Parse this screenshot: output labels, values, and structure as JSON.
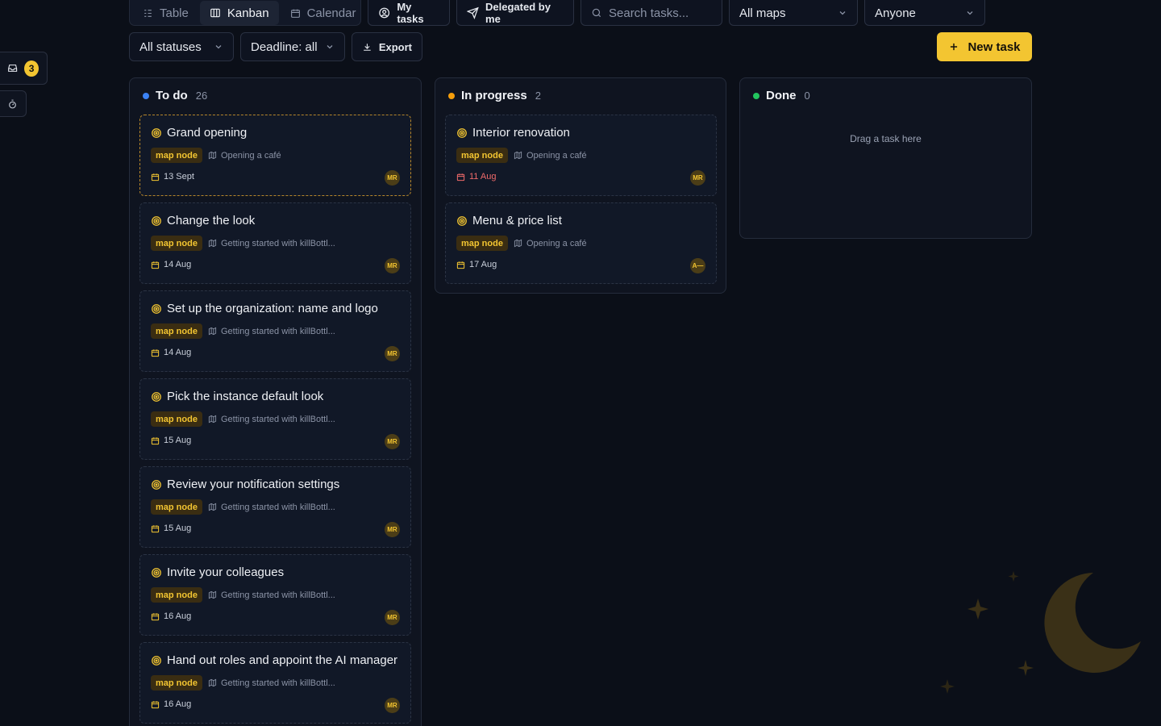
{
  "rail": {
    "inbox_count": "3"
  },
  "toolbar": {
    "views": [
      {
        "label": "Table",
        "icon": "table-icon"
      },
      {
        "label": "Kanban",
        "icon": "kanban-icon"
      },
      {
        "label": "Calendar",
        "icon": "calendar-icon"
      }
    ],
    "my_tasks": "My tasks",
    "delegated": "Delegated by me",
    "search_placeholder": "Search tasks...",
    "maps_filter": "All maps",
    "assignee_filter": "Anyone",
    "status_filter": "All statuses",
    "deadline_filter": "Deadline: all",
    "export": "Export",
    "new_task": "New task"
  },
  "colors": {
    "accent": "#f3c531",
    "todo": "#3b82f6",
    "in_progress": "#f59e0b",
    "done": "#22c55e",
    "overdue": "#ef6a6a"
  },
  "columns": [
    {
      "title": "To do",
      "count": "26",
      "cards": [
        {
          "title": "Grand opening",
          "tag": "map node",
          "map": "Opening a café",
          "due": "13 Sept",
          "assignee": "MR"
        },
        {
          "title": "Change the look",
          "tag": "map node",
          "map": "Getting started with killBottl...",
          "due": "14 Aug",
          "assignee": "MR"
        },
        {
          "title": "Set up the organization: name and logo",
          "tag": "map node",
          "map": "Getting started with killBottl...",
          "due": "14 Aug",
          "assignee": "MR"
        },
        {
          "title": "Pick the instance default look",
          "tag": "map node",
          "map": "Getting started with killBottl...",
          "due": "15 Aug",
          "assignee": "MR"
        },
        {
          "title": "Review your notification settings",
          "tag": "map node",
          "map": "Getting started with killBottl...",
          "due": "15 Aug",
          "assignee": "MR"
        },
        {
          "title": "Invite your colleagues",
          "tag": "map node",
          "map": "Getting started with killBottl...",
          "due": "16 Aug",
          "assignee": "MR"
        },
        {
          "title": "Hand out roles and appoint the AI manager",
          "tag": "map node",
          "map": "Getting started with killBottl...",
          "due": "16 Aug",
          "assignee": "MR"
        }
      ]
    },
    {
      "title": "In progress",
      "count": "2",
      "cards": [
        {
          "title": "Interior renovation",
          "tag": "map node",
          "map": "Opening a café",
          "due": "11 Aug",
          "assignee": "MR"
        },
        {
          "title": "Menu & price list",
          "tag": "map node",
          "map": "Opening a café",
          "due": "17 Aug",
          "assignee": "A—"
        }
      ]
    },
    {
      "title": "Done",
      "count": "0",
      "empty_hint": "Drag a task here"
    }
  ]
}
